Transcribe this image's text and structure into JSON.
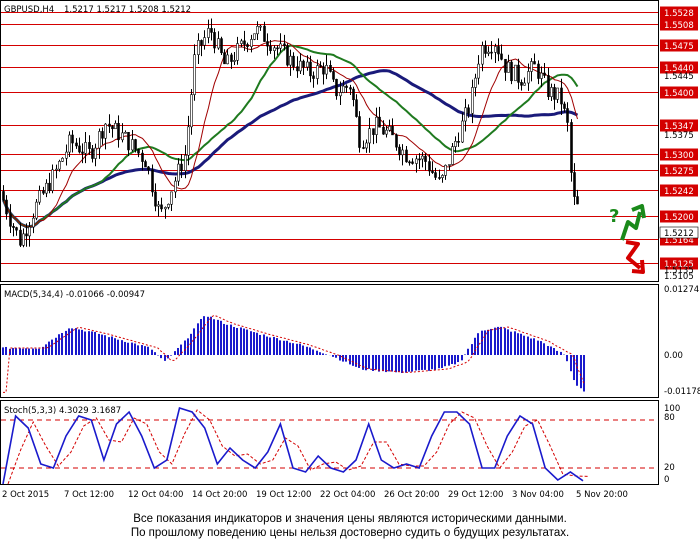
{
  "header": {
    "symbol": "GBPUSD,H4",
    "ohlc": "1.5217 1.5217 1.5208 1.5212",
    "macd_title": "MACD(5,34,4) -0.01066 -0.00947",
    "stoch_title": "Stoch(5,3,3) 4.3029 3.1687"
  },
  "levels": [
    {
      "label": "1.5528",
      "value": 1.5528
    },
    {
      "label": "1.5508",
      "value": 1.5508
    },
    {
      "label": "1.5475",
      "value": 1.5475
    },
    {
      "label": "1.5440",
      "value": 1.544
    },
    {
      "label": "1.5400",
      "value": 1.54
    },
    {
      "label": "1.5347",
      "value": 1.5347
    },
    {
      "label": "1.5300",
      "value": 1.53
    },
    {
      "label": "1.5275",
      "value": 1.5275
    },
    {
      "label": "1.5242",
      "value": 1.5242
    },
    {
      "label": "1.5200",
      "value": 1.52
    },
    {
      "label": "1.5164",
      "value": 1.5164
    },
    {
      "label": "1.5125",
      "value": 1.5125
    }
  ],
  "price_ticks": [
    "1.5445",
    "1.5375",
    "1.5212",
    "1.5135",
    "1.5105"
  ],
  "current_price": "1.5212",
  "macd_ticks": [
    "0.01274",
    "0.00",
    "-0.01178"
  ],
  "stoch_ticks": [
    "100",
    "80",
    "20",
    "0"
  ],
  "x_labels": [
    "2 Oct 2015",
    "7 Oct 12:00",
    "12 Oct 04:00",
    "14 Oct 20:00",
    "19 Oct 12:00",
    "22 Oct 04:00",
    "26 Oct 20:00",
    "29 Oct 12:00",
    "3 Nov 04:00",
    "5 Nov 20:00"
  ],
  "annotation": "?",
  "colors": {
    "level_line": "#d40000",
    "ma_blue": "#1a1a7a",
    "ma_green": "#1f7a1f",
    "ma_red": "#a00000",
    "macd_bar": "#1a1acc",
    "signal": "#d40000",
    "stoch_main": "#1a1acc",
    "stoch_signal": "#d40000",
    "arrow_up": "#1a8a1a",
    "arrow_down": "#d40000"
  },
  "chart_data": {
    "type": "line",
    "series": [
      {
        "x": [
          "2 Oct 2015",
          "7 Oct 12:00",
          "12 Oct 04:00",
          "14 Oct 20:00",
          "19 Oct 12:00",
          "22 Oct 04:00",
          "26 Oct 20:00",
          "29 Oct 12:00",
          "3 Nov 04:00",
          "5 Nov 20:00"
        ],
        "values": [
          1.5195,
          1.529,
          1.5225,
          1.548,
          1.545,
          1.536,
          1.5265,
          1.545,
          1.54,
          1.5212
        ]
      }
    ],
    "macd": [
      0.001,
      0.006,
      0.008,
      0.012,
      0.007,
      -0.004,
      -0.004,
      0.007,
      0.004,
      -0.0107
    ],
    "stoch": [
      80,
      25,
      85,
      95,
      30,
      20,
      15,
      90,
      70,
      4
    ]
  },
  "disclaimer": [
    "Все показания индикаторов и значения цены являются историческими данными.",
    "По прошлому поведению цены нельзя достоверно судить о будущих результатах."
  ]
}
